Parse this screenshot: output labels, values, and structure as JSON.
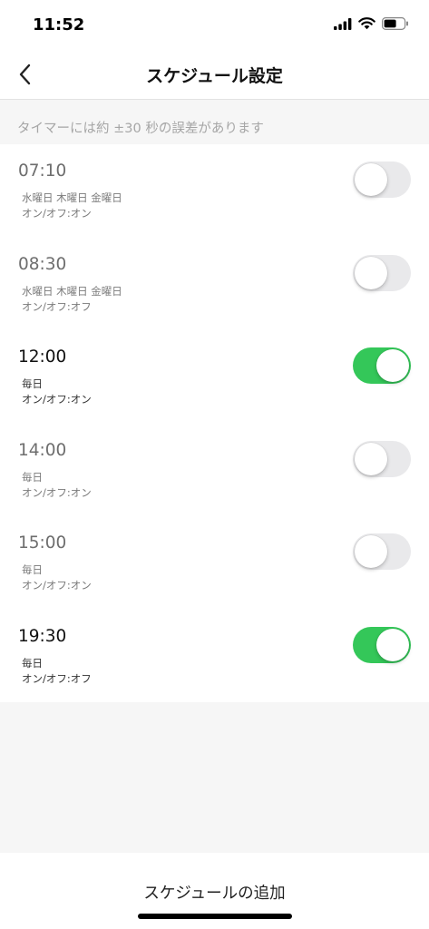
{
  "status": {
    "time": "11:52"
  },
  "header": {
    "title": "スケジュール設定"
  },
  "notice": "タイマーには約 ±30 秒の誤差があります",
  "schedules": [
    {
      "time": "07:10",
      "days": "水曜日 木曜日 金曜日",
      "action": "オン/オフ:オン",
      "enabled": false
    },
    {
      "time": "08:30",
      "days": "水曜日 木曜日 金曜日",
      "action": "オン/オフ:オフ",
      "enabled": false
    },
    {
      "time": "12:00",
      "days": "毎日",
      "action": "オン/オフ:オン",
      "enabled": true
    },
    {
      "time": "14:00",
      "days": "毎日",
      "action": "オン/オフ:オン",
      "enabled": false
    },
    {
      "time": "15:00",
      "days": "毎日",
      "action": "オン/オフ:オン",
      "enabled": false
    },
    {
      "time": "19:30",
      "days": "毎日",
      "action": "オン/オフ:オフ",
      "enabled": true
    }
  ],
  "footer": {
    "add_label": "スケジュールの追加"
  },
  "colors": {
    "toggle_on": "#34c759",
    "toggle_off": "#e9e9eb"
  }
}
